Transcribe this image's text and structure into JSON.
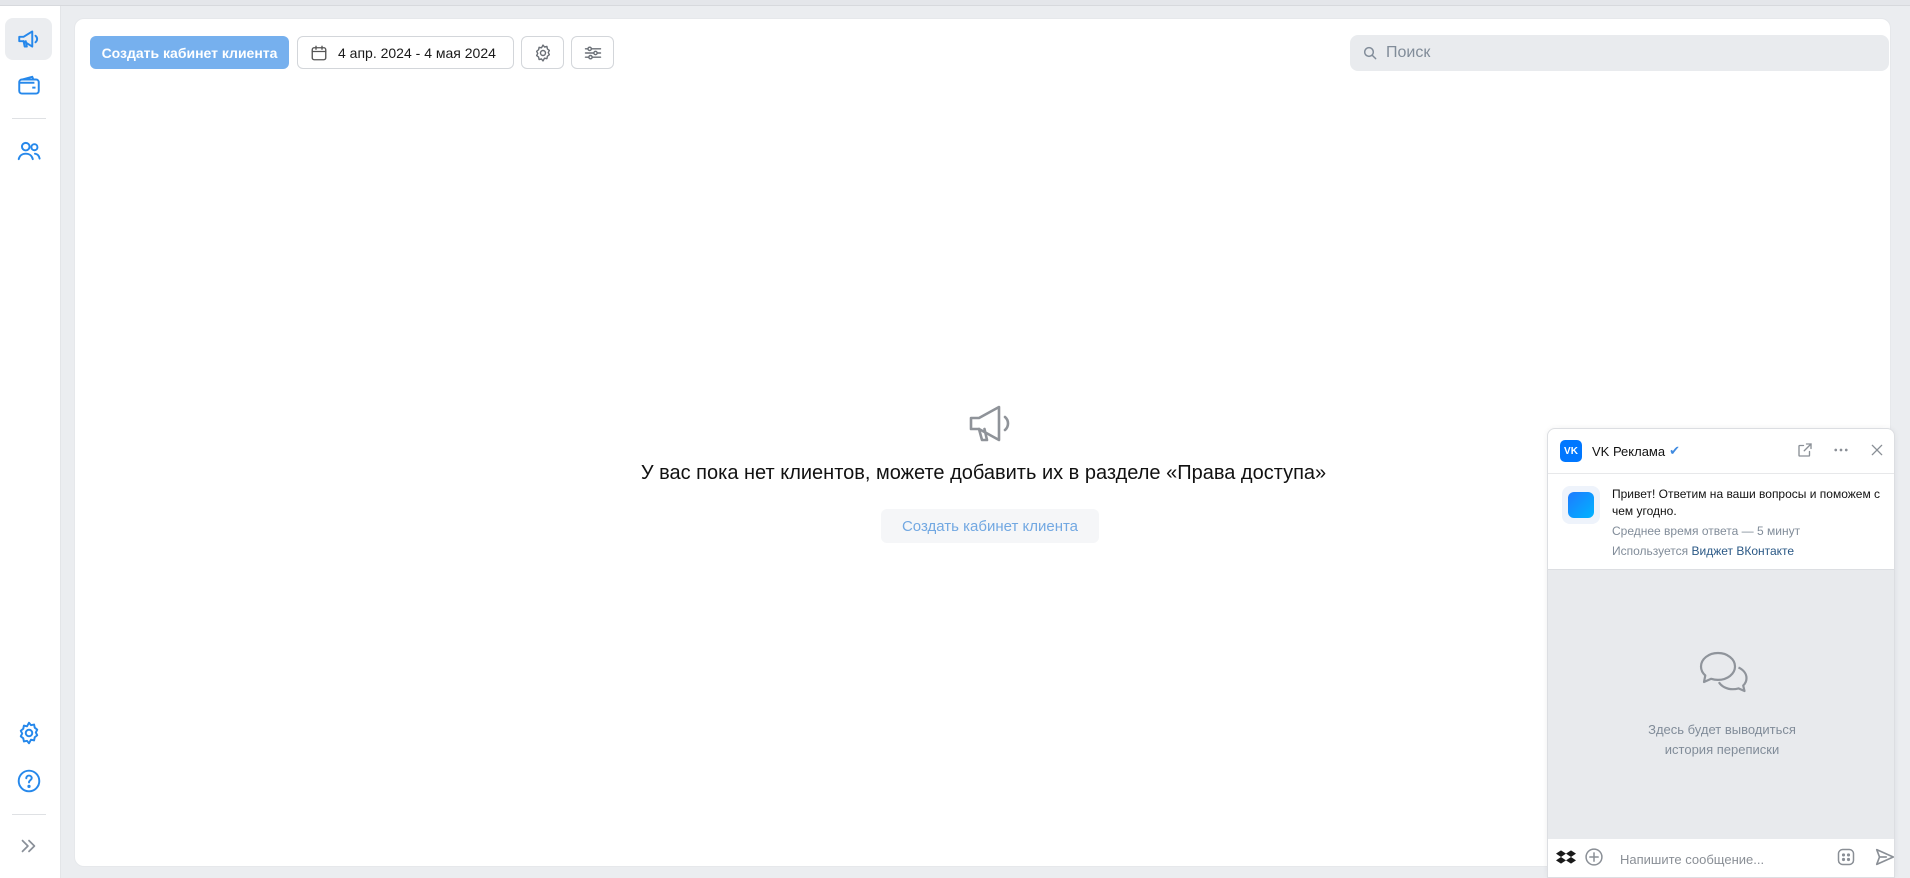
{
  "toolbar": {
    "create_button": "Создать кабинет клиента",
    "date_range": "4 апр. 2024 - 4 мая 2024",
    "search_placeholder": "Поиск"
  },
  "sidebar": {
    "items": [
      {
        "icon": "megaphone-icon",
        "active": true
      },
      {
        "icon": "wallet-icon",
        "active": false
      },
      {
        "icon": "users-icon",
        "active": false
      },
      {
        "icon": "gear-icon",
        "active": false
      },
      {
        "icon": "help-icon",
        "active": false
      },
      {
        "icon": "expand-icon",
        "active": false
      }
    ]
  },
  "empty_state": {
    "icon": "megaphone-icon",
    "text": "У вас пока нет клиентов, можете добавить их в разделе «Права доступа»",
    "button": "Создать кабинет клиента"
  },
  "chat": {
    "title": "VK Реклама",
    "logo_text": "VK",
    "greeting": "Привет! Ответим на ваши вопросы и поможем с чем угодно.",
    "response_time": "Среднее время ответа — 5 минут",
    "powered_prefix": "Используется",
    "powered_link": "Виджет ВКонтакте",
    "empty_line1": "Здесь будет выводиться",
    "empty_line2": "история переписки",
    "input_placeholder": "Напишите сообщение..."
  },
  "colors": {
    "primary": "#76b0ee",
    "accent": "#2688eb",
    "background": "#ebedf0",
    "vk_blue": "#0077ff"
  }
}
